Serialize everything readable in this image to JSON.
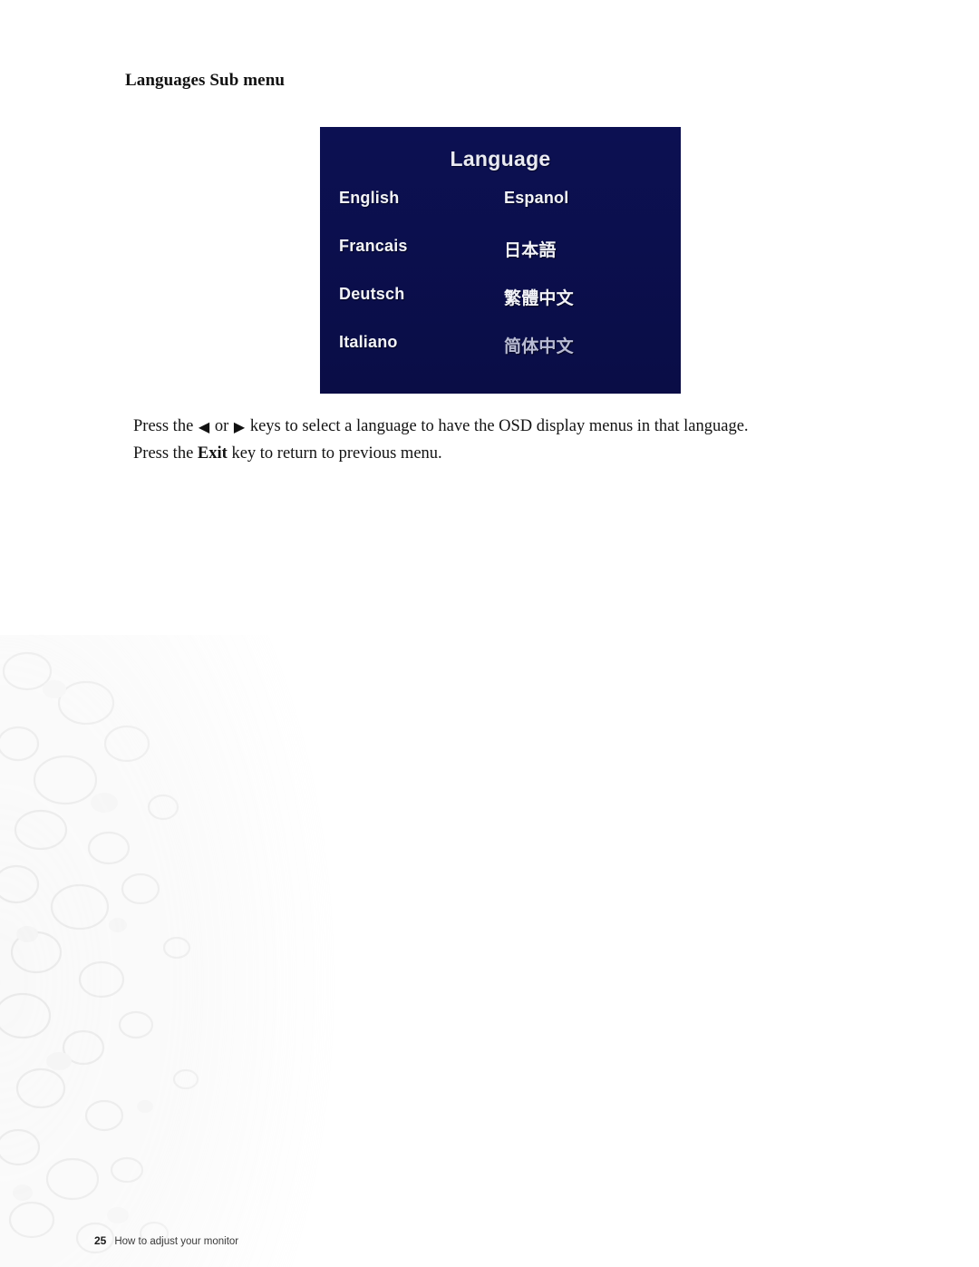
{
  "page": {
    "heading": "Languages Sub menu"
  },
  "osd": {
    "title": "Language",
    "bg_color": "#0c1052",
    "text_color": "#f2f3f8",
    "rows": [
      {
        "left": "English",
        "right": "Espanol"
      },
      {
        "left": "Francais",
        "right": "日本語"
      },
      {
        "left": "Deutsch",
        "right": "繁體中文"
      },
      {
        "left": "Italiano",
        "right": "简体中文"
      }
    ]
  },
  "body": {
    "line1_part1": "Press the",
    "left_arrow_icon": "left-triangle-icon",
    "left_arrow_glyph": "◀",
    "or": "or",
    "right_arrow_icon": "right-triangle-icon",
    "right_arrow_glyph": "▶",
    "line1_part2": "keys to select a language to have the OSD display menus in that language.",
    "line2_part1": "Press the",
    "exit_key": "Exit",
    "line2_part2": "key to return to previous menu."
  },
  "footer": {
    "page_number": "25",
    "section": "How to adjust your monitor"
  }
}
